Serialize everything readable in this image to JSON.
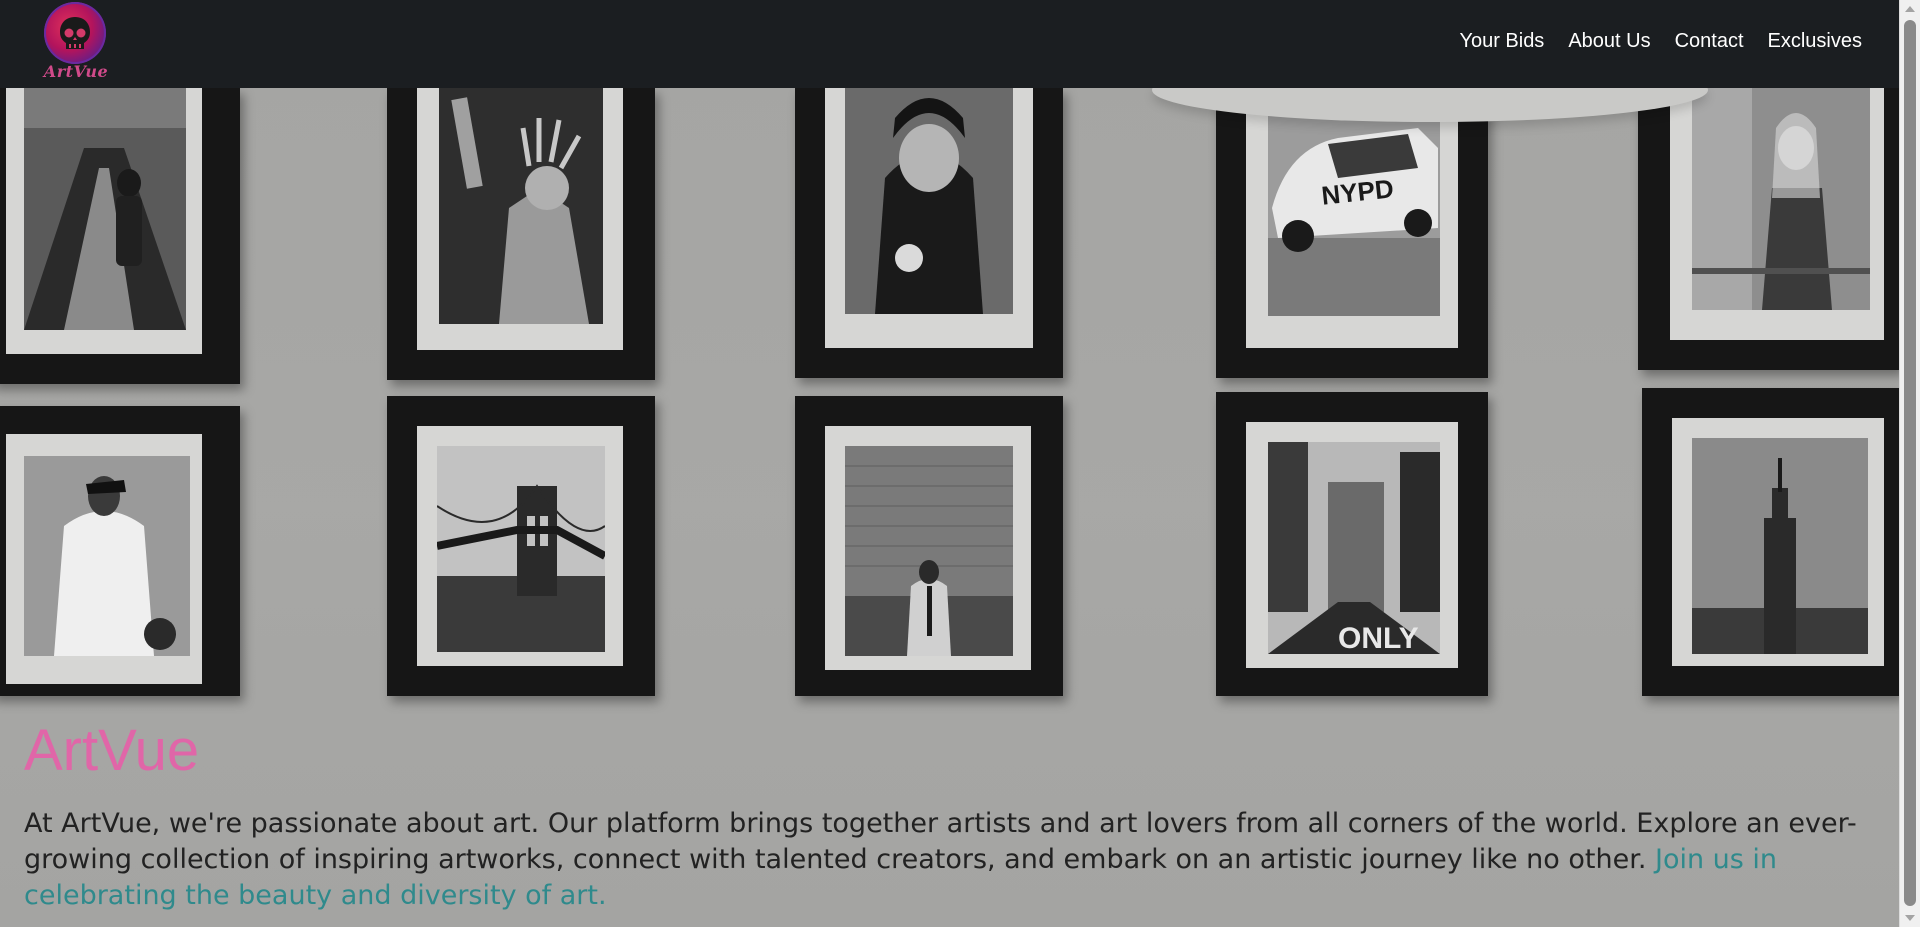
{
  "logo": {
    "text": "ArtVue",
    "icon": "skull-logo-icon"
  },
  "nav": {
    "items": [
      {
        "label": "Your Bids"
      },
      {
        "label": "About Us"
      },
      {
        "label": "Contact"
      },
      {
        "label": "Exclusives"
      }
    ]
  },
  "hero": {
    "title": "ArtVue",
    "description": "At ArtVue, we're passionate about art. Our platform brings together artists and art lovers from all corners of the world. Explore an ever-growing collection of inspiring artworks, connect with talented creators, and embark on an artistic journey like no other. ",
    "highlight": "Join us in celebrating the beauty and diversity of art.",
    "frame_labels": {
      "nypd": "NYPD",
      "only": "ONLY"
    }
  },
  "colors": {
    "navbar_bg": "#1b1e21",
    "nav_text": "#ffffff",
    "title_pink": "#e066a8",
    "highlight_teal": "#2f8a8c",
    "body_text": "#222222"
  }
}
